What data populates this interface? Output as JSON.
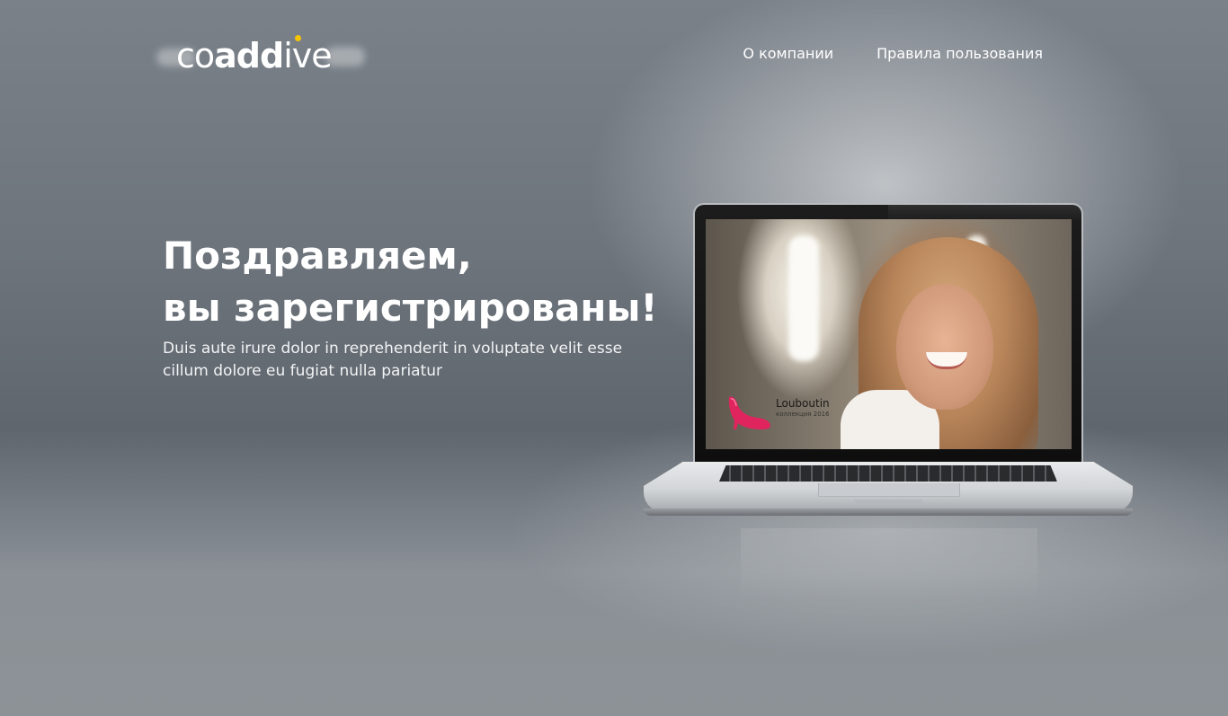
{
  "header": {
    "logo": {
      "part_light_1": "co",
      "part_bold": "add",
      "part_light_2": "ive",
      "dot_color": "#f4c400"
    },
    "nav": [
      {
        "label": "О компании"
      },
      {
        "label": "Правила пользования"
      }
    ]
  },
  "hero": {
    "title_line1": "Поздравляем,",
    "title_line2": "вы зарегистрированы!",
    "subtitle": "Duis aute irure dolor in reprehenderit in voluptate velit esse cillum dolore eu fugiat nulla pariatur"
  },
  "laptop": {
    "screen": {
      "promo_title": "Louboutin",
      "promo_sub": "коллекция 2016",
      "promo_icon": "high-heel-shoe-icon",
      "shoe_color": "#e0245e"
    }
  }
}
